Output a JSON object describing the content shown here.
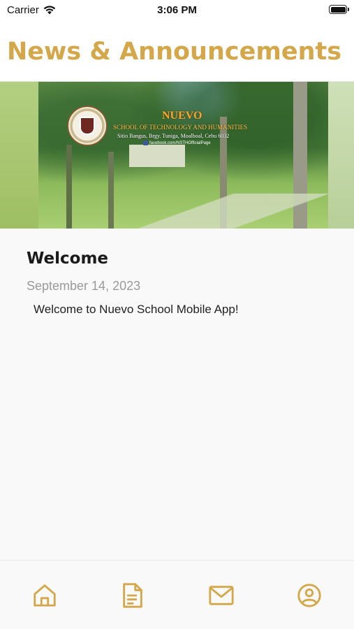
{
  "status_bar": {
    "carrier": "Carrier",
    "time": "3:06 PM",
    "battery_level": 1.0
  },
  "header": {
    "title": "News & Announcements"
  },
  "banner": {
    "school_name": "NUEVO",
    "school_subtitle": "SCHOOL OF TECHNOLOGY AND HUMANITIES",
    "address": "Sitio Bangus, Brgy. Tuniga, Moalboal, Cebu 6032",
    "facebook": "facebook.com/NSTHOfficialPage",
    "logo_text": "NUEVO"
  },
  "news": {
    "title": "Welcome",
    "date": "September 14, 2023",
    "body": "Welcome to Nuevo School Mobile App!"
  },
  "tab_bar": {
    "accent": "#d4a74a",
    "tabs": [
      {
        "icon": "home-icon"
      },
      {
        "icon": "document-icon"
      },
      {
        "icon": "mail-icon"
      },
      {
        "icon": "profile-icon"
      }
    ]
  }
}
